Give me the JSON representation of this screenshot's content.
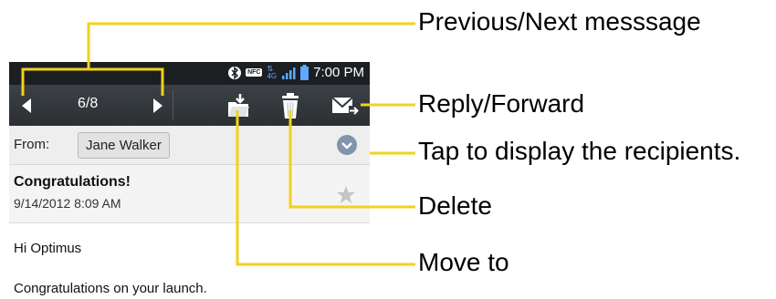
{
  "status_bar": {
    "time": "7:00 PM",
    "nfc_label": "NFC",
    "network_label": "4G",
    "icons": [
      "bluetooth-icon",
      "nfc-icon",
      "network-4g-icon",
      "signal-icon",
      "battery-icon"
    ]
  },
  "toolbar": {
    "message_counter": "6/8",
    "icons": [
      "previous-arrow-icon",
      "next-arrow-icon",
      "move-to-folder-icon",
      "delete-trash-icon",
      "reply-forward-icon"
    ]
  },
  "message": {
    "from_label": "From:",
    "sender": "Jane Walker",
    "subject": "Congratulations!",
    "date": "9/14/2012 8:09 AM",
    "greeting": "Hi Optimus",
    "body": "Congratulations on your launch."
  },
  "callouts": {
    "prev_next": "Previous/Next messsage",
    "reply_forward": "Reply/Forward",
    "recipients": "Tap to display the recipients.",
    "delete": "Delete",
    "move_to": "Move to"
  },
  "colors": {
    "callout_line": "#f2d21b",
    "toolbar": "#33383c",
    "status_bar": "#1b1f22",
    "expand_button": "#8094ab"
  }
}
